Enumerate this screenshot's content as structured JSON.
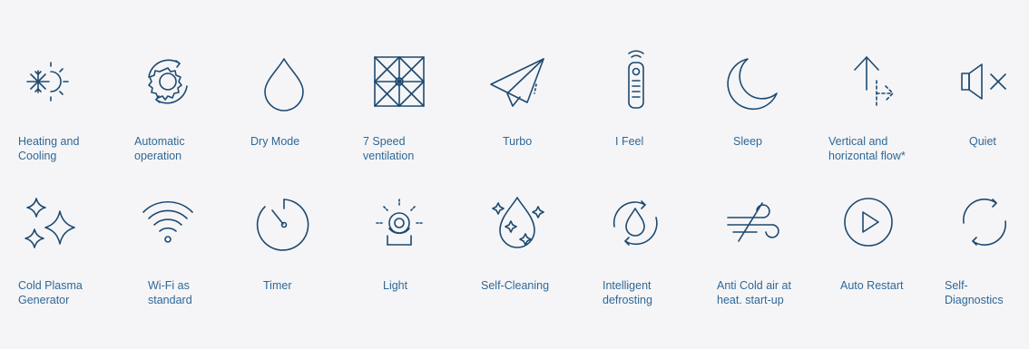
{
  "colors": {
    "background": "#f5f5f7",
    "icon": "#1d4a71",
    "label": "#2f6896"
  },
  "features": [
    {
      "label": "Heating and\nCooling",
      "icon": "snowflake-sun-icon"
    },
    {
      "label": "Automatic\noperation",
      "icon": "auto-gear-icon"
    },
    {
      "label": "Dry Mode",
      "icon": "droplet-icon"
    },
    {
      "label": "7 Speed\nventilation",
      "icon": "pinwheel-icon"
    },
    {
      "label": "Turbo",
      "icon": "paper-plane-icon"
    },
    {
      "label": "I Feel",
      "icon": "remote-control-icon"
    },
    {
      "label": "Sleep",
      "icon": "moon-icon"
    },
    {
      "label": "Vertical and\nhorizontal flow*",
      "icon": "airflow-arrows-icon"
    },
    {
      "label": "Quiet",
      "icon": "speaker-mute-icon"
    },
    {
      "label": "Cold Plasma\nGenerator",
      "icon": "sparkles-icon"
    },
    {
      "label": "Wi-Fi as\nstandard",
      "icon": "wifi-icon"
    },
    {
      "label": "Timer",
      "icon": "timer-icon"
    },
    {
      "label": "Light",
      "icon": "light-icon"
    },
    {
      "label": "Self-Cleaning",
      "icon": "clean-drop-icon"
    },
    {
      "label": "Intelligent\ndefrosting",
      "icon": "defrost-icon"
    },
    {
      "label": "Anti Cold air at\nheat. start-up",
      "icon": "wind-no-cold-icon"
    },
    {
      "label": "Auto Restart",
      "icon": "play-icon"
    },
    {
      "label": "Self-\nDiagnostics",
      "icon": "refresh-icon"
    }
  ]
}
